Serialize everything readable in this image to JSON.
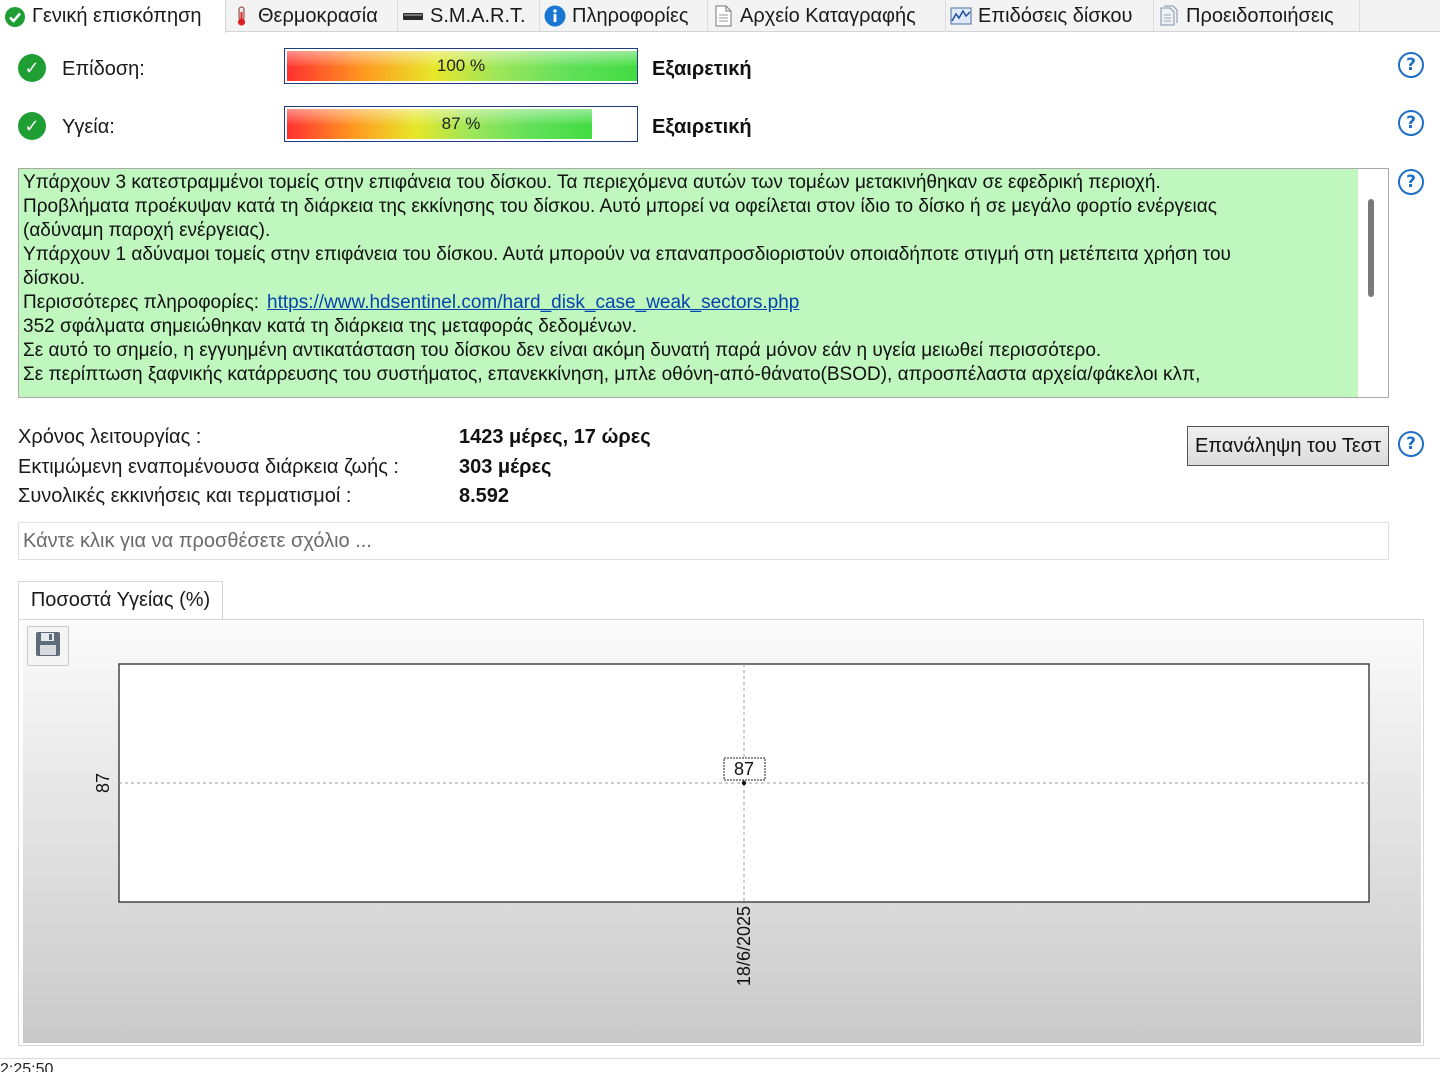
{
  "tabs": [
    {
      "label": "Γενική επισκόπηση",
      "icon": "check-circle-icon",
      "active": true
    },
    {
      "label": "Θερμοκρασία",
      "icon": "thermometer-icon",
      "active": false
    },
    {
      "label": "S.M.A.R.T.",
      "icon": "drive-icon",
      "active": false
    },
    {
      "label": "Πληροφορίες",
      "icon": "info-icon",
      "active": false
    },
    {
      "label": "Αρχείο Καταγραφής",
      "icon": "log-document-icon",
      "active": false
    },
    {
      "label": "Επιδόσεις δίσκου",
      "icon": "performance-chart-icon",
      "active": false
    },
    {
      "label": "Προειδοποιήσεις",
      "icon": "alerts-document-icon",
      "active": false
    }
  ],
  "performance": {
    "label": "Επίδοση:",
    "bar_text": "100 %",
    "value": 100,
    "rating": "Εξαιρετική"
  },
  "health": {
    "label": "Υγεία:",
    "bar_text": "87 %",
    "value": 87,
    "rating": "Εξαιρετική"
  },
  "messages": {
    "lines": [
      "Υπάρχουν 3 κατεστραμμένοι τομείς στην επιφάνεια του δίσκου. Τα περιεχόμενα αυτών των τομέων μετακινήθηκαν σε εφεδρική περιοχή.",
      "Προβλήματα προέκυψαν κατά τη διάρκεια της εκκίνησης του δίσκου. Αυτό μπορεί να οφείλεται στον ίδιο το δίσκο ή σε μεγάλο φορτίο ενέργειας",
      "(αδύναμη παροχή ενέργειας).",
      "Υπάρχουν 1 αδύναμοι τομείς στην επιφάνεια του δίσκου. Αυτά μπορούν να επαναπροσδιοριστούν οποιαδήποτε στιγμή στη μετέπειτα χρήση του",
      "δίσκου."
    ],
    "more_info_label": "Περισσότερες πληροφορίες:",
    "more_info_link": "https://www.hdsentinel.com/hard_disk_case_weak_sectors.php",
    "lines_after": [
      "352 σφάλματα σημειώθηκαν κατά τη διάρκεια της μεταφοράς δεδομένων.",
      "Σε αυτό το σημείο, η εγγυημένη αντικατάσταση του δίσκου δεν είναι ακόμη δυνατή παρά μόνον εάν η υγεία μειωθεί περισσότερο.",
      "Σε περίπτωση ξαφνικής κατάρρευσης του συστήματος, επανεκκίνηση, μπλε οθόνη-από-θάνατο(BSOD), απροσπέλαστα αρχεία/φάκελοι κλπ,"
    ]
  },
  "info": {
    "uptime_label": "Χρόνος λειτουργίας :",
    "uptime_value": "1423 μέρες, 17 ώρες",
    "lifetime_label": "Εκτιμώμενη εναπομένουσα διάρκεια ζωής :",
    "lifetime_value": "303 μέρες",
    "startups_label": "Συνολικές εκκινήσεις και τερματισμοί :",
    "startups_value": "8.592"
  },
  "retest_button": "Επανάληψη του Τεστ",
  "comment": {
    "placeholder": "Κάντε κλικ για να προσθέσετε σχόλιο ..."
  },
  "chart_tab": "Ποσοστά Υγείας (%)",
  "chart_data": {
    "type": "line",
    "title": "",
    "xlabel": "",
    "ylabel": "",
    "categories": [
      "18/6/2025"
    ],
    "series": [
      {
        "values": [
          87
        ]
      }
    ],
    "y_tick_labels": [
      "87"
    ],
    "point_labels": [
      "87"
    ],
    "grid": true,
    "legend": "none"
  },
  "footer": {
    "time": "2:25:50"
  },
  "colors": {
    "ok_green": "#1e9e33",
    "message_bg": "#bff7bf",
    "help_blue": "#1f6fc7",
    "link": "#0645ad"
  }
}
